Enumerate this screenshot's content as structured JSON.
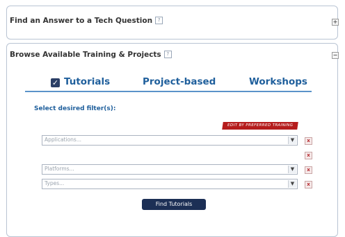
{
  "question_panel": {
    "title": "Find an Answer to a Tech Question",
    "help_icon": "?",
    "toggle": "+"
  },
  "training_panel": {
    "title": "Browse Available Training & Projects",
    "help_icon": "?",
    "toggle": "−",
    "tabs": [
      {
        "label": "Tutorials",
        "checked": true,
        "check_glyph": "✓"
      },
      {
        "label": "Project-based"
      },
      {
        "label": "Workshops"
      }
    ],
    "filter_label": "Select desired filter(s):",
    "edit_badge": "EDIT BY PREFERRED TRAINING",
    "selects": [
      {
        "placeholder": "Applications..."
      },
      {
        "placeholder": "Platforms..."
      },
      {
        "placeholder": "Types..."
      }
    ],
    "remove_glyph": "x",
    "dropdown_glyph": "▼",
    "find_button": "Find Tutorials"
  },
  "colors": {
    "tab_text": "#1f5f9c",
    "checkbox": "#2b3f66",
    "button": "#1c2f55",
    "badge": "#b51c1c",
    "remove": "#b3262b"
  }
}
